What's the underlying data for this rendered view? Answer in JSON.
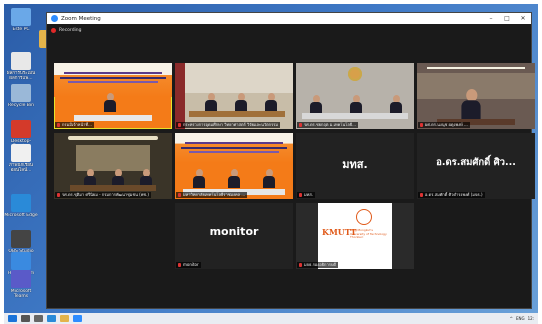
{
  "window": {
    "title": "Zoom Meeting",
    "minimize": "–",
    "maximize": "□",
    "close": "✕"
  },
  "recording": {
    "label": "Recording"
  },
  "desktop": {
    "icons": [
      {
        "label": "Este PC",
        "color": "#6aa8e8"
      },
      {
        "label": "",
        "color": "#e3b34a"
      },
      {
        "label": "ผลการประเมิน ผลการแพ...",
        "color": "#e8e8e8"
      },
      {
        "label": "Recycle Bin",
        "color": "#9ab8d8"
      },
      {
        "label": "Desktop-Dzmt...",
        "color": "#d43a2a"
      },
      {
        "label": "ภาพนักเรียนออนไลน์...",
        "color": "#f0f0f0"
      },
      {
        "label": "Microsoft Edge",
        "color": "#2a8ad8"
      },
      {
        "label": "OBS Studio",
        "color": "#444444"
      },
      {
        "label": "Hand Zoom",
        "color": "#3a8ae0"
      },
      {
        "label": "Microsoft Teams",
        "color": "#5a5ac8"
      }
    ]
  },
  "tiles": [
    {
      "name": "กรมมีเจ้าหน้าที่...",
      "kind": "banner",
      "active": true
    },
    {
      "name": "กระทรวงการอุดมศึกษา วิทยาศาสตร์ วิจัยและนวัตกรรม",
      "kind": "room"
    },
    {
      "name": "รศ.ดร.ชยกฤต ม.เทคโนโลยี...",
      "kind": "podium"
    },
    {
      "name": "ผศ.ดร.นงนุช ผดุงพงษ์ ...",
      "kind": "office"
    },
    {
      "name": "รศ.ดร.ชุติมา ศรีนิยม - กรมการพัฒนาชุมชน (พช.)",
      "kind": "hall"
    },
    {
      "name": "มหาวิทยาลัยเทคโนโลยีราชมงคล ...",
      "kind": "banner2"
    },
    {
      "name": "มทส.",
      "kind": "text",
      "text": "มทส."
    },
    {
      "name": "อ.ดร.สมศักดิ์ ศิวดำรงพงศ์ (มจธ.)",
      "kind": "text",
      "text": "อ.ดร.สมศักดิ์ ศิว..."
    },
    {
      "name": "monitor",
      "kind": "text",
      "text": "monitor"
    },
    {
      "name": "มจธ.รองอธิการบดี",
      "kind": "logo",
      "logo_text": "KMUTT",
      "logo_sub": "King Mongkut's University of Technology Thonburi"
    }
  ],
  "taskbar": {
    "apps": [
      "start-icon",
      "search-icon",
      "task-view-icon",
      "edge-icon",
      "explorer-icon",
      "zoom-icon"
    ],
    "tray": {
      "lang": "ENG",
      "time": "12:"
    }
  }
}
